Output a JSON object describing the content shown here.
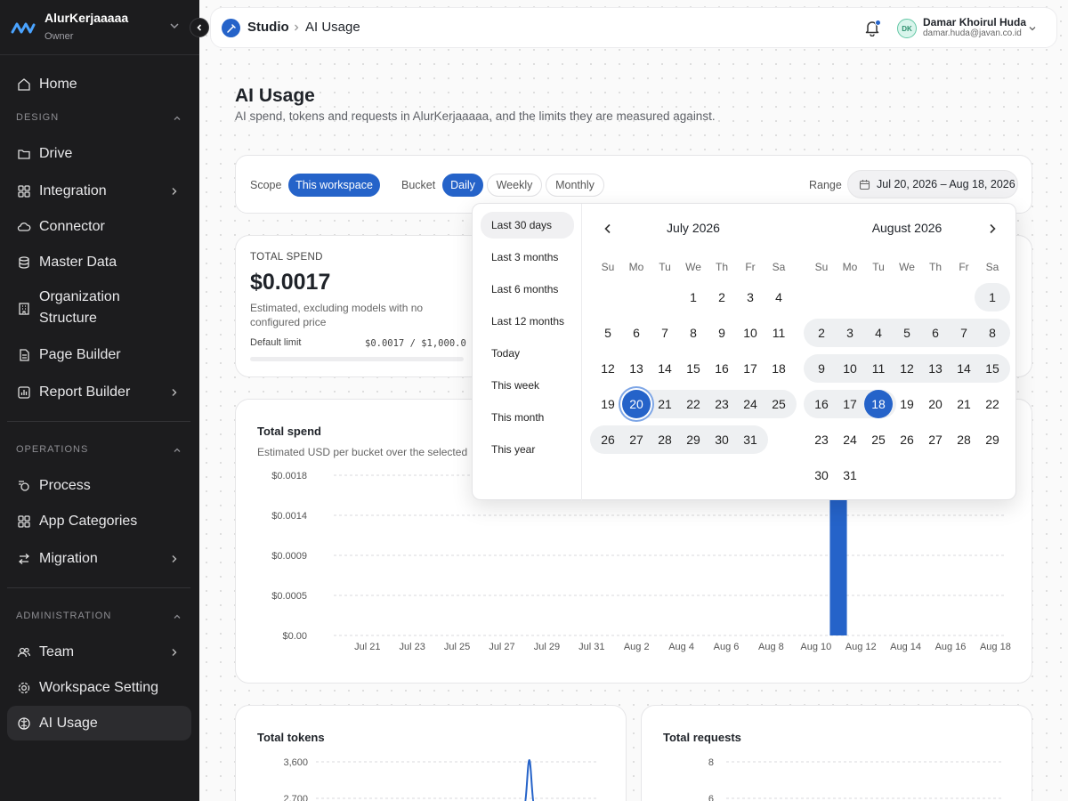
{
  "sidebar": {
    "workspace_name": "AlurKerjaaaaa",
    "workspace_role": "Owner",
    "home": "Home",
    "sections": {
      "design": "DESIGN",
      "operations": "OPERATIONS",
      "administration": "ADMINISTRATION"
    },
    "design_items": [
      "Drive",
      "Integration",
      "Connector",
      "Master Data",
      "Organization Structure",
      "Page Builder",
      "Report Builder"
    ],
    "operations_items": [
      "Process",
      "App Categories",
      "Migration"
    ],
    "administration_items": [
      "Team",
      "Workspace Setting",
      "AI Usage"
    ],
    "active_item": "AI Usage"
  },
  "topbar": {
    "crumb_root": "Studio",
    "crumb_current": "AI Usage",
    "user_initials": "DK",
    "user_name": "Damar Khoirul Huda",
    "user_email": "damar.huda@javan.co.id",
    "accent_color": "#2563c9"
  },
  "page": {
    "title": "AI Usage",
    "subtitle": "AI spend, tokens and requests in AlurKerjaaaaa, and the limits they are measured against."
  },
  "filters": {
    "scope_label": "Scope",
    "scope_value": "This workspace",
    "bucket_label": "Bucket",
    "bucket_options": [
      "Daily",
      "Weekly",
      "Monthly"
    ],
    "bucket_selected": "Daily",
    "range_label": "Range",
    "range_value": "Jul 20, 2026 – Aug 18, 2026"
  },
  "spend_card": {
    "label": "TOTAL SPEND",
    "value": "$0.0017",
    "note": "Estimated, excluding models with no configured price",
    "limit_label": "Default limit",
    "limit_value": "$0.0017 / $1,000.0"
  },
  "date_picker": {
    "presets": [
      "Last 30 days",
      "Last 3 months",
      "Last 6 months",
      "Last 12 months",
      "Today",
      "This week",
      "This month",
      "This year"
    ],
    "selected_preset": "Last 30 days",
    "weekdays": [
      "Su",
      "Mo",
      "Tu",
      "We",
      "Th",
      "Fr",
      "Sa"
    ],
    "months": [
      {
        "title": "July 2026",
        "first_weekday": 3,
        "days": 31
      },
      {
        "title": "August 2026",
        "first_weekday": 6,
        "days": 31
      }
    ],
    "range_start": "July 2026|20",
    "range_end": "August 2026|18"
  },
  "spend_chart_text": {
    "title": "Total spend",
    "subtitle": "Estimated USD per bucket over the selected"
  },
  "tokens_chart_text": {
    "title": "Total tokens"
  },
  "requests_chart_text": {
    "title": "Total requests"
  },
  "chart_data": [
    {
      "type": "bar",
      "title": "Total spend",
      "ylabel": "",
      "xlabel": "",
      "yticks": [
        "$0.00",
        "$0.0005",
        "$0.0009",
        "$0.0014",
        "$0.0018"
      ],
      "ylim": [
        0,
        0.0018
      ],
      "xticks": [
        "Jul 21",
        "Jul 23",
        "Jul 25",
        "Jul 27",
        "Jul 29",
        "Jul 31",
        "Aug 2",
        "Aug 4",
        "Aug 6",
        "Aug 8",
        "Aug 10",
        "Aug 12",
        "Aug 14",
        "Aug 16",
        "Aug 18"
      ],
      "categories": [
        "Jul 20",
        "Jul 21",
        "Jul 22",
        "Jul 23",
        "Jul 24",
        "Jul 25",
        "Jul 26",
        "Jul 27",
        "Jul 28",
        "Jul 29",
        "Jul 30",
        "Jul 31",
        "Aug 1",
        "Aug 2",
        "Aug 3",
        "Aug 4",
        "Aug 5",
        "Aug 6",
        "Aug 7",
        "Aug 8",
        "Aug 9",
        "Aug 10",
        "Aug 11",
        "Aug 12",
        "Aug 13",
        "Aug 14",
        "Aug 15",
        "Aug 16",
        "Aug 17",
        "Aug 18"
      ],
      "values": [
        0,
        0,
        0,
        0,
        0,
        0,
        0,
        0,
        0,
        0,
        0,
        0,
        0,
        0,
        0,
        0,
        0,
        0,
        0,
        0,
        0,
        0,
        0.0017,
        0,
        0,
        0,
        0,
        0,
        0,
        0
      ],
      "color": "#2563c9",
      "grid": true
    },
    {
      "type": "line",
      "title": "Total tokens",
      "yticks": [
        "3,600",
        "2,700"
      ],
      "categories": [
        "Jul 20",
        "Jul 21",
        "Jul 22",
        "Jul 23",
        "Jul 24",
        "Jul 25",
        "Jul 26",
        "Jul 27",
        "Jul 28",
        "Jul 29",
        "Jul 30",
        "Jul 31",
        "Aug 1",
        "Aug 2",
        "Aug 3",
        "Aug 4",
        "Aug 5",
        "Aug 6",
        "Aug 7",
        "Aug 8",
        "Aug 9",
        "Aug 10",
        "Aug 11",
        "Aug 12",
        "Aug 13",
        "Aug 14",
        "Aug 15",
        "Aug 16",
        "Aug 17",
        "Aug 18"
      ],
      "values": [
        0,
        0,
        0,
        0,
        0,
        0,
        0,
        0,
        0,
        0,
        0,
        0,
        0,
        0,
        0,
        0,
        0,
        0,
        0,
        0,
        0,
        0,
        3600,
        0,
        0,
        0,
        0,
        0,
        0,
        0
      ],
      "color": "#2563c9",
      "grid": true
    },
    {
      "type": "line",
      "title": "Total requests",
      "yticks": [
        "8",
        "6"
      ],
      "grid": true
    }
  ]
}
